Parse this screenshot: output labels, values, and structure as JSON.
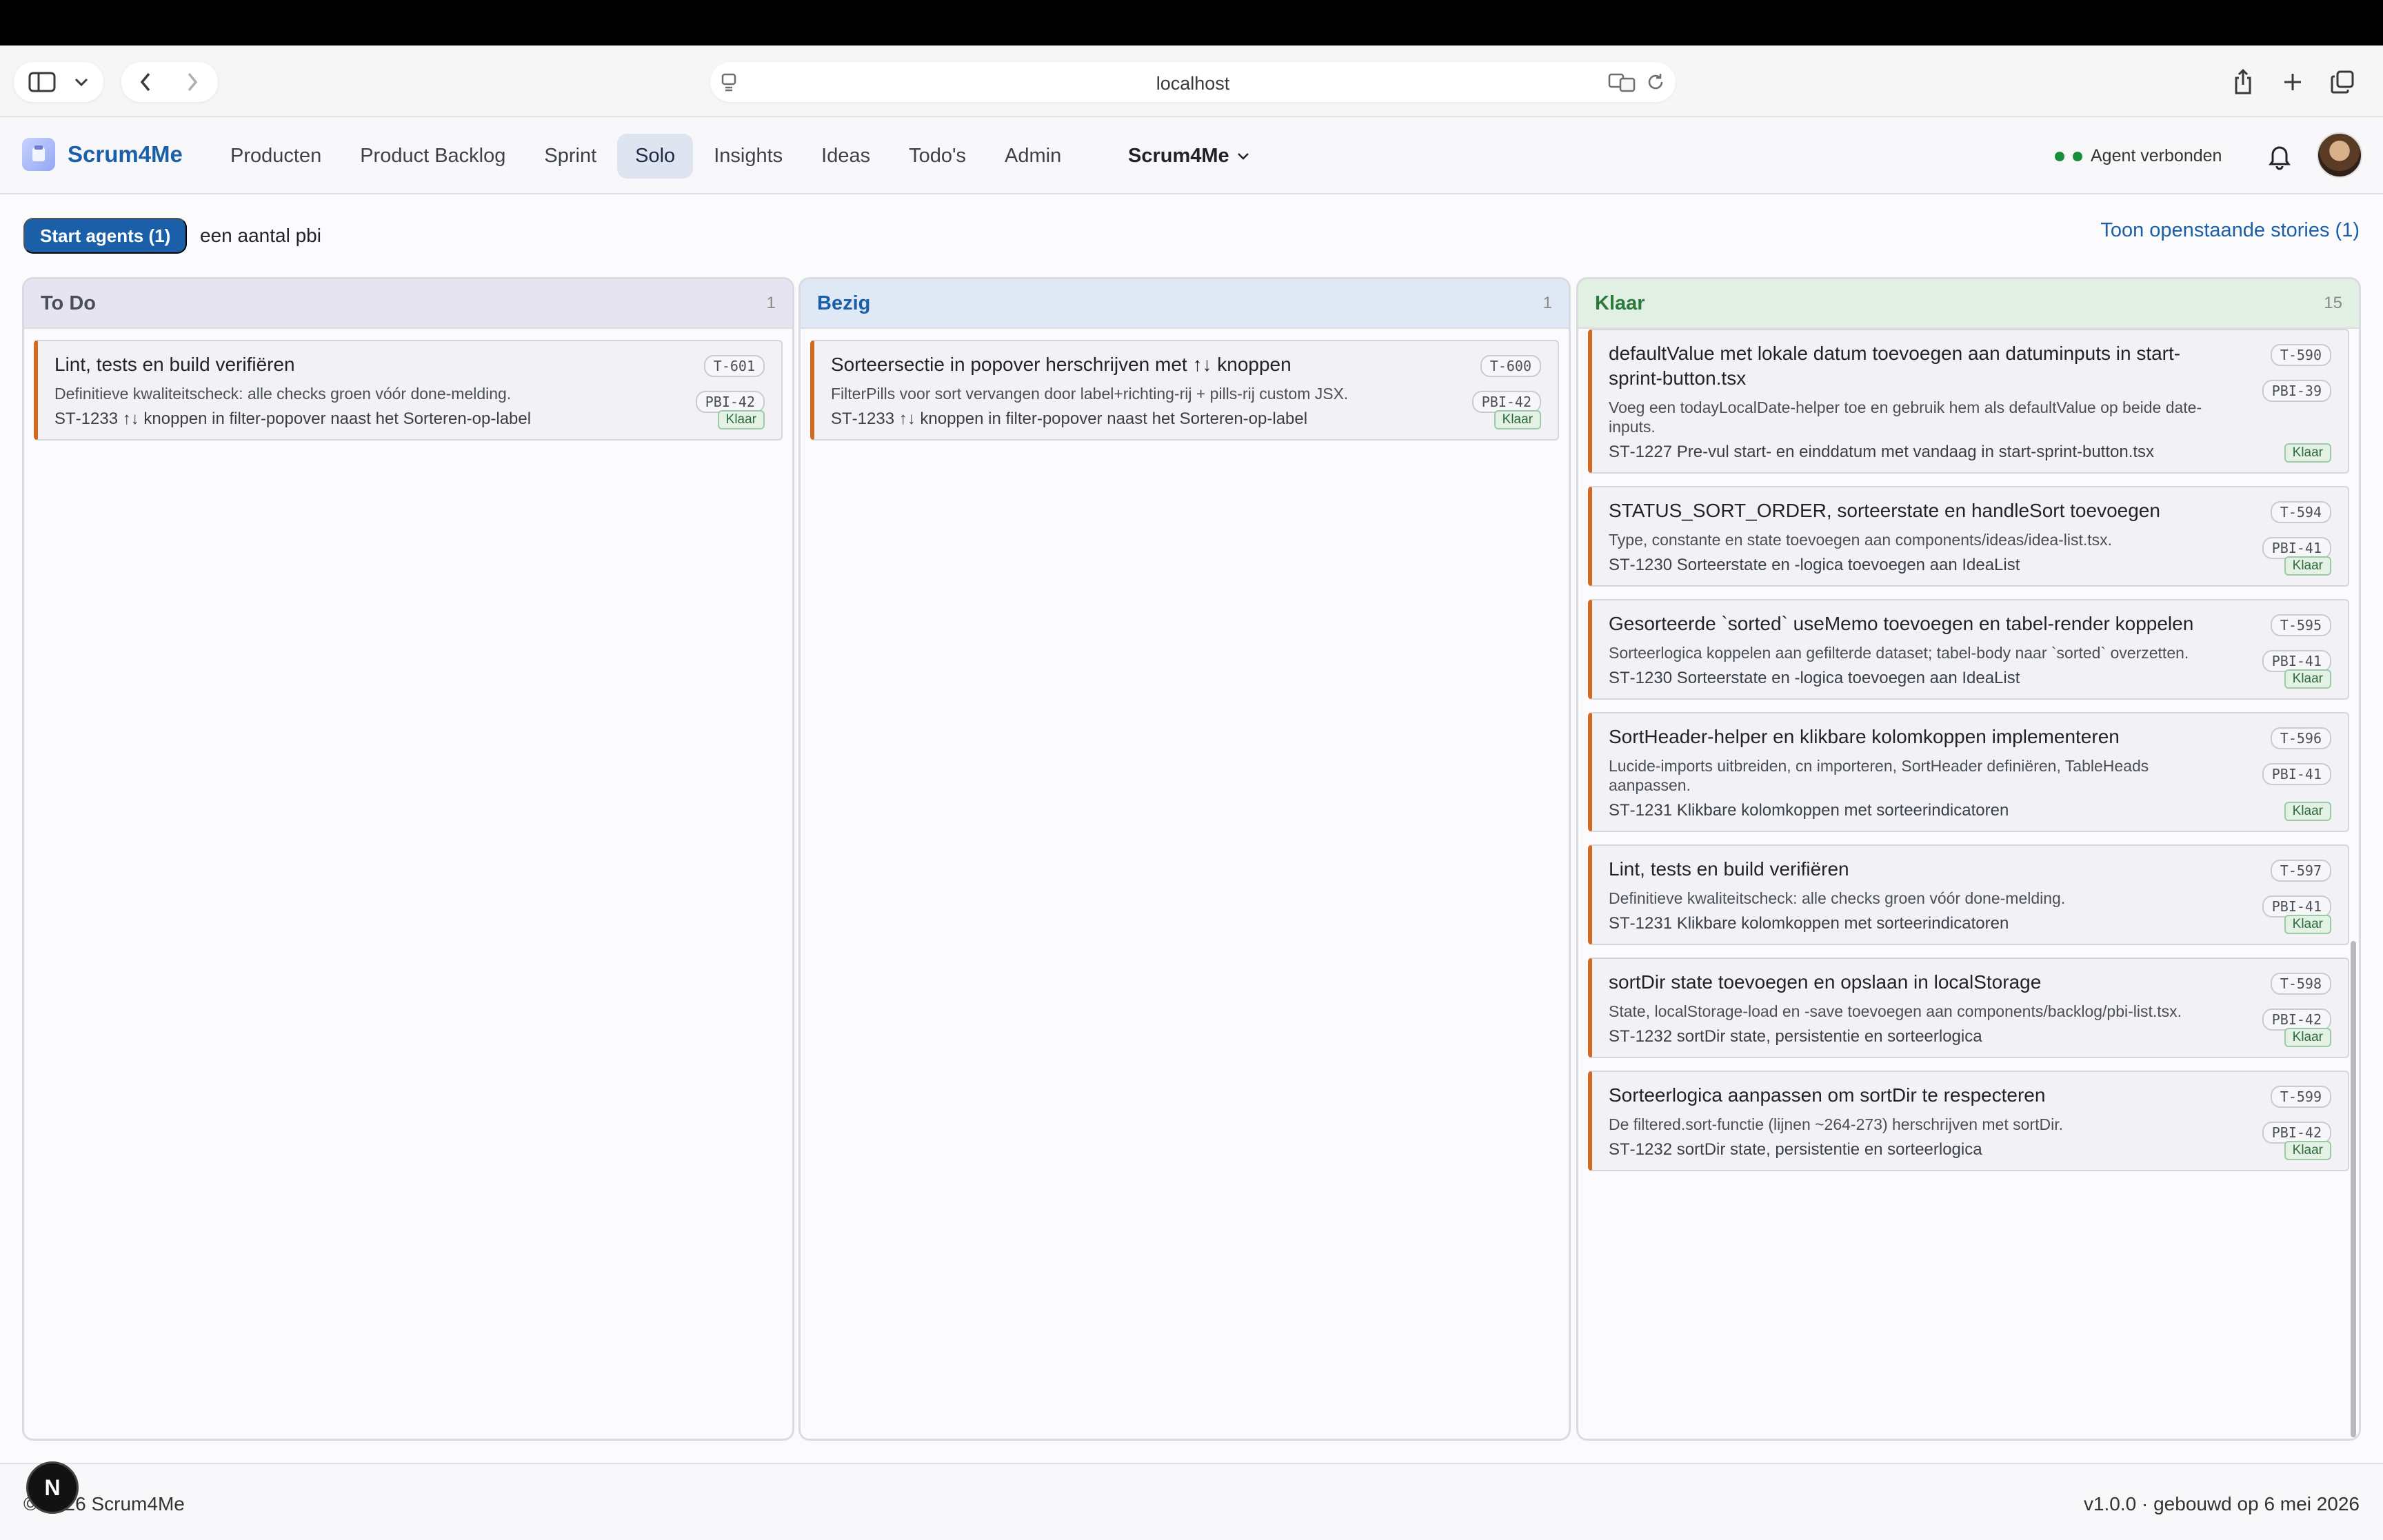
{
  "browser": {
    "url": "localhost"
  },
  "nav": {
    "brand": "Scrum4Me",
    "links": [
      "Producten",
      "Product Backlog",
      "Sprint",
      "Solo",
      "Insights",
      "Ideas",
      "Todo's",
      "Admin"
    ],
    "active": "Solo",
    "project": "Scrum4Me",
    "agent_status": "Agent verbonden"
  },
  "toolbar": {
    "start_agents": "Start agents (1)",
    "pbi_filter": "een aantal pbi",
    "open_stories": "Toon openstaande stories (1)"
  },
  "columns": [
    {
      "title": "To Do",
      "count": "1",
      "color": "#e7e4f2",
      "title_color": "#4a4f57",
      "cards": [
        {
          "title": "Lint, tests en build verifiëren",
          "desc": "Definitieve kwaliteitscheck: alle checks groen vóór done-melding.",
          "story": "ST‑1233 ↑↓ knoppen in filter-popover naast het Sorteren-op-label",
          "task": "T‑601",
          "pbi": "PBI‑42",
          "status": "Klaar"
        }
      ]
    },
    {
      "title": "Bezig",
      "count": "1",
      "color": "#dfe8f5",
      "title_color": "#1a5fa8",
      "cards": [
        {
          "title": "Sorteersectie in popover herschrijven met ↑↓ knoppen",
          "desc": "FilterPills voor sort vervangen door label+richting-rij + pills-rij custom JSX.",
          "story": "ST‑1233 ↑↓ knoppen in filter-popover naast het Sorteren-op-label",
          "task": "T‑600",
          "pbi": "PBI‑42",
          "status": "Klaar"
        }
      ]
    },
    {
      "title": "Klaar",
      "count": "15",
      "color": "#e2efe3",
      "title_color": "#2a7a3c",
      "cards": [
        {
          "title": "defaultValue met lokale datum toevoegen aan datuminputs in start-sprint-button.tsx",
          "desc": "Voeg een todayLocalDate-helper toe en gebruik hem als defaultValue op beide date-inputs.",
          "story": "ST‑1227 Pre-vul start- en einddatum met vandaag in start-sprint-button.tsx",
          "task": "T‑590",
          "pbi": "PBI‑39",
          "status": "Klaar"
        },
        {
          "title": "STATUS_SORT_ORDER, sorteerstate en handleSort toevoegen",
          "desc": "Type, constante en state toevoegen aan components/ideas/idea-list.tsx.",
          "story": "ST‑1230 Sorteerstate en -logica toevoegen aan IdeaList",
          "task": "T‑594",
          "pbi": "PBI‑41",
          "status": "Klaar"
        },
        {
          "title": "Gesorteerde `sorted` useMemo toevoegen en tabel-render koppelen",
          "desc": "Sorteerlogica koppelen aan gefilterde dataset; tabel-body naar `sorted` overzetten.",
          "story": "ST‑1230 Sorteerstate en -logica toevoegen aan IdeaList",
          "task": "T‑595",
          "pbi": "PBI‑41",
          "status": "Klaar"
        },
        {
          "title": "SortHeader-helper en klikbare kolomkoppen implementeren",
          "desc": "Lucide-imports uitbreiden, cn importeren, SortHeader definiëren, TableHeads aanpassen.",
          "story": "ST‑1231 Klikbare kolomkoppen met sorteerindicatoren",
          "task": "T‑596",
          "pbi": "PBI‑41",
          "status": "Klaar"
        },
        {
          "title": "Lint, tests en build verifiëren",
          "desc": "Definitieve kwaliteitscheck: alle checks groen vóór done-melding.",
          "story": "ST‑1231 Klikbare kolomkoppen met sorteerindicatoren",
          "task": "T‑597",
          "pbi": "PBI‑41",
          "status": "Klaar"
        },
        {
          "title": "sortDir state toevoegen en opslaan in localStorage",
          "desc": "State, localStorage-load en -save toevoegen aan components/backlog/pbi-list.tsx.",
          "story": "ST‑1232 sortDir state, persistentie en sorteerlogica",
          "task": "T‑598",
          "pbi": "PBI‑42",
          "status": "Klaar"
        },
        {
          "title": "Sorteerlogica aanpassen om sortDir te respecteren",
          "desc": "De filtered.sort-functie (lijnen ~264-273) herschrijven met sortDir.",
          "story": "ST‑1232 sortDir state, persistentie en sorteerlogica",
          "task": "T‑599",
          "pbi": "PBI‑42",
          "status": "Klaar"
        }
      ]
    }
  ],
  "footer": {
    "left": "© 2026 Scrum4Me",
    "right": "v1.0.0 · gebouwd op 6 mei 2026",
    "badge": "N"
  }
}
